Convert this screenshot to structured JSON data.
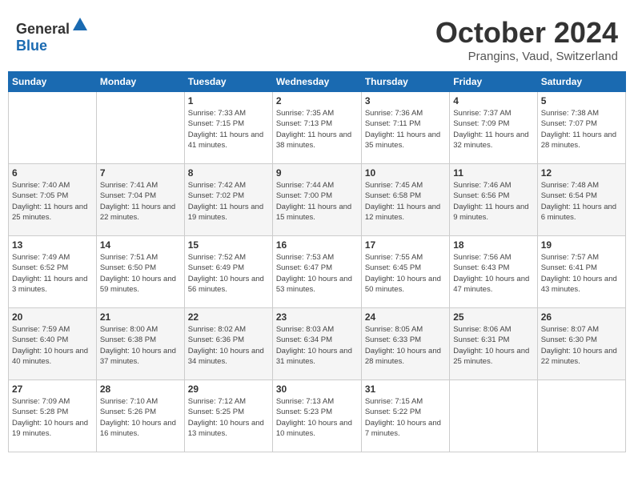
{
  "header": {
    "logo_general": "General",
    "logo_blue": "Blue",
    "month": "October 2024",
    "location": "Prangins, Vaud, Switzerland"
  },
  "columns": [
    "Sunday",
    "Monday",
    "Tuesday",
    "Wednesday",
    "Thursday",
    "Friday",
    "Saturday"
  ],
  "weeks": [
    [
      {
        "num": "",
        "info": ""
      },
      {
        "num": "",
        "info": ""
      },
      {
        "num": "1",
        "info": "Sunrise: 7:33 AM\nSunset: 7:15 PM\nDaylight: 11 hours and 41 minutes."
      },
      {
        "num": "2",
        "info": "Sunrise: 7:35 AM\nSunset: 7:13 PM\nDaylight: 11 hours and 38 minutes."
      },
      {
        "num": "3",
        "info": "Sunrise: 7:36 AM\nSunset: 7:11 PM\nDaylight: 11 hours and 35 minutes."
      },
      {
        "num": "4",
        "info": "Sunrise: 7:37 AM\nSunset: 7:09 PM\nDaylight: 11 hours and 32 minutes."
      },
      {
        "num": "5",
        "info": "Sunrise: 7:38 AM\nSunset: 7:07 PM\nDaylight: 11 hours and 28 minutes."
      }
    ],
    [
      {
        "num": "6",
        "info": "Sunrise: 7:40 AM\nSunset: 7:05 PM\nDaylight: 11 hours and 25 minutes."
      },
      {
        "num": "7",
        "info": "Sunrise: 7:41 AM\nSunset: 7:04 PM\nDaylight: 11 hours and 22 minutes."
      },
      {
        "num": "8",
        "info": "Sunrise: 7:42 AM\nSunset: 7:02 PM\nDaylight: 11 hours and 19 minutes."
      },
      {
        "num": "9",
        "info": "Sunrise: 7:44 AM\nSunset: 7:00 PM\nDaylight: 11 hours and 15 minutes."
      },
      {
        "num": "10",
        "info": "Sunrise: 7:45 AM\nSunset: 6:58 PM\nDaylight: 11 hours and 12 minutes."
      },
      {
        "num": "11",
        "info": "Sunrise: 7:46 AM\nSunset: 6:56 PM\nDaylight: 11 hours and 9 minutes."
      },
      {
        "num": "12",
        "info": "Sunrise: 7:48 AM\nSunset: 6:54 PM\nDaylight: 11 hours and 6 minutes."
      }
    ],
    [
      {
        "num": "13",
        "info": "Sunrise: 7:49 AM\nSunset: 6:52 PM\nDaylight: 11 hours and 3 minutes."
      },
      {
        "num": "14",
        "info": "Sunrise: 7:51 AM\nSunset: 6:50 PM\nDaylight: 10 hours and 59 minutes."
      },
      {
        "num": "15",
        "info": "Sunrise: 7:52 AM\nSunset: 6:49 PM\nDaylight: 10 hours and 56 minutes."
      },
      {
        "num": "16",
        "info": "Sunrise: 7:53 AM\nSunset: 6:47 PM\nDaylight: 10 hours and 53 minutes."
      },
      {
        "num": "17",
        "info": "Sunrise: 7:55 AM\nSunset: 6:45 PM\nDaylight: 10 hours and 50 minutes."
      },
      {
        "num": "18",
        "info": "Sunrise: 7:56 AM\nSunset: 6:43 PM\nDaylight: 10 hours and 47 minutes."
      },
      {
        "num": "19",
        "info": "Sunrise: 7:57 AM\nSunset: 6:41 PM\nDaylight: 10 hours and 43 minutes."
      }
    ],
    [
      {
        "num": "20",
        "info": "Sunrise: 7:59 AM\nSunset: 6:40 PM\nDaylight: 10 hours and 40 minutes."
      },
      {
        "num": "21",
        "info": "Sunrise: 8:00 AM\nSunset: 6:38 PM\nDaylight: 10 hours and 37 minutes."
      },
      {
        "num": "22",
        "info": "Sunrise: 8:02 AM\nSunset: 6:36 PM\nDaylight: 10 hours and 34 minutes."
      },
      {
        "num": "23",
        "info": "Sunrise: 8:03 AM\nSunset: 6:34 PM\nDaylight: 10 hours and 31 minutes."
      },
      {
        "num": "24",
        "info": "Sunrise: 8:05 AM\nSunset: 6:33 PM\nDaylight: 10 hours and 28 minutes."
      },
      {
        "num": "25",
        "info": "Sunrise: 8:06 AM\nSunset: 6:31 PM\nDaylight: 10 hours and 25 minutes."
      },
      {
        "num": "26",
        "info": "Sunrise: 8:07 AM\nSunset: 6:30 PM\nDaylight: 10 hours and 22 minutes."
      }
    ],
    [
      {
        "num": "27",
        "info": "Sunrise: 7:09 AM\nSunset: 5:28 PM\nDaylight: 10 hours and 19 minutes."
      },
      {
        "num": "28",
        "info": "Sunrise: 7:10 AM\nSunset: 5:26 PM\nDaylight: 10 hours and 16 minutes."
      },
      {
        "num": "29",
        "info": "Sunrise: 7:12 AM\nSunset: 5:25 PM\nDaylight: 10 hours and 13 minutes."
      },
      {
        "num": "30",
        "info": "Sunrise: 7:13 AM\nSunset: 5:23 PM\nDaylight: 10 hours and 10 minutes."
      },
      {
        "num": "31",
        "info": "Sunrise: 7:15 AM\nSunset: 5:22 PM\nDaylight: 10 hours and 7 minutes."
      },
      {
        "num": "",
        "info": ""
      },
      {
        "num": "",
        "info": ""
      }
    ]
  ]
}
